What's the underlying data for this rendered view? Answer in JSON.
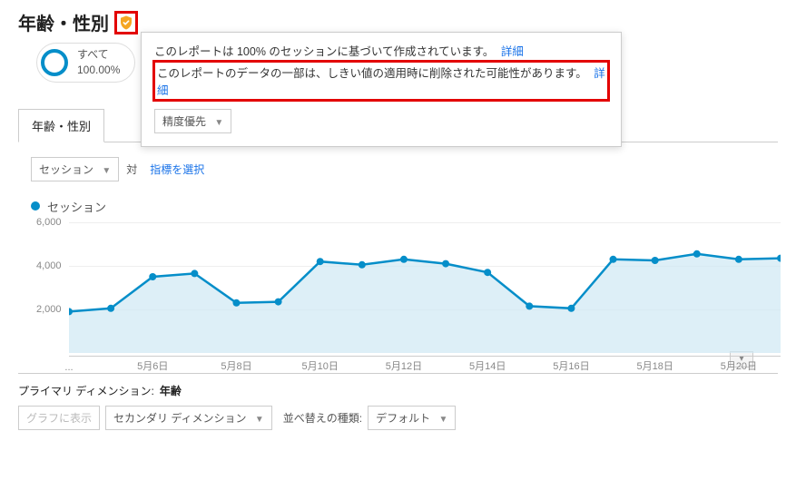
{
  "page_title": "年齢・性別",
  "pill": {
    "label_top": "すべて",
    "label_bottom": "100.00%"
  },
  "popup": {
    "sampling_msg": "このレポートは 100% のセッションに基づいて作成されています。",
    "sampling_link": "詳細",
    "threshold_msg": "このレポートのデータの一部は、しきい値の適用時に削除された可能性があります。",
    "threshold_link": "詳細",
    "precision_label": "精度優先"
  },
  "tab_label": "年齢・性別",
  "toolbar": {
    "metric_dd": "セッション",
    "vs": "対",
    "picker_link": "指標を選択"
  },
  "legend_label": "セッション",
  "primary_dim": {
    "label": "プライマリ ディメンション:",
    "value": "年齢"
  },
  "controls": {
    "graph_btn": "グラフに表示",
    "secondary": "セカンダリ ディメンション",
    "sort_label": "並べ替えの種類:",
    "sort_value": "デフォルト"
  },
  "chart_data": {
    "type": "line",
    "ylabel": "",
    "series_name": "セッション",
    "yticks": [
      2000,
      4000,
      6000
    ],
    "ytick_labels": [
      "2,000",
      "4,000",
      "6,000"
    ],
    "xtick_labels": [
      "...",
      "5月6日",
      "5月8日",
      "5月10日",
      "5月12日",
      "5月14日",
      "5月16日",
      "5月18日",
      "5月20日"
    ],
    "x_days": [
      4,
      5,
      6,
      7,
      8,
      9,
      10,
      11,
      12,
      13,
      14,
      15,
      16,
      17,
      18,
      19,
      20,
      21
    ],
    "values": [
      1900,
      2050,
      3500,
      3650,
      2300,
      2350,
      4200,
      4050,
      4300,
      4100,
      3700,
      2150,
      2050,
      4300,
      4250,
      4550,
      4300,
      4350
    ],
    "ylim": [
      0,
      6000
    ]
  }
}
